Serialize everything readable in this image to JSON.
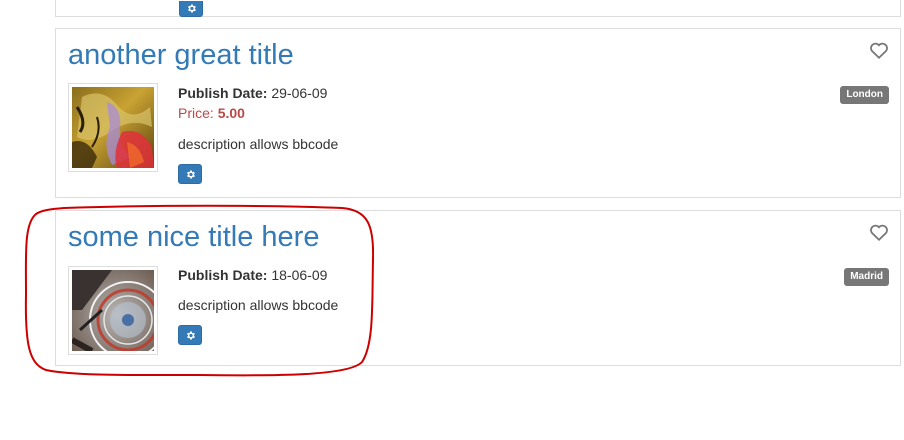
{
  "listings": [
    {
      "title": "another great title",
      "publish_label": "Publish Date:",
      "publish_date": "29-06-09",
      "price_label": "Price:",
      "price_value": "5.00",
      "description": "description allows bbcode",
      "location": "London",
      "image": "abstract-painting-thumbnail"
    },
    {
      "title": "some nice title here",
      "publish_label": "Publish Date:",
      "publish_date": "18-06-09",
      "description": "description allows bbcode",
      "location": "Madrid",
      "image": "turntable-thumbnail"
    }
  ],
  "colors": {
    "link": "#337ab7",
    "price": "#b94a48",
    "badge": "#777777",
    "highlight": "#cc0000"
  }
}
